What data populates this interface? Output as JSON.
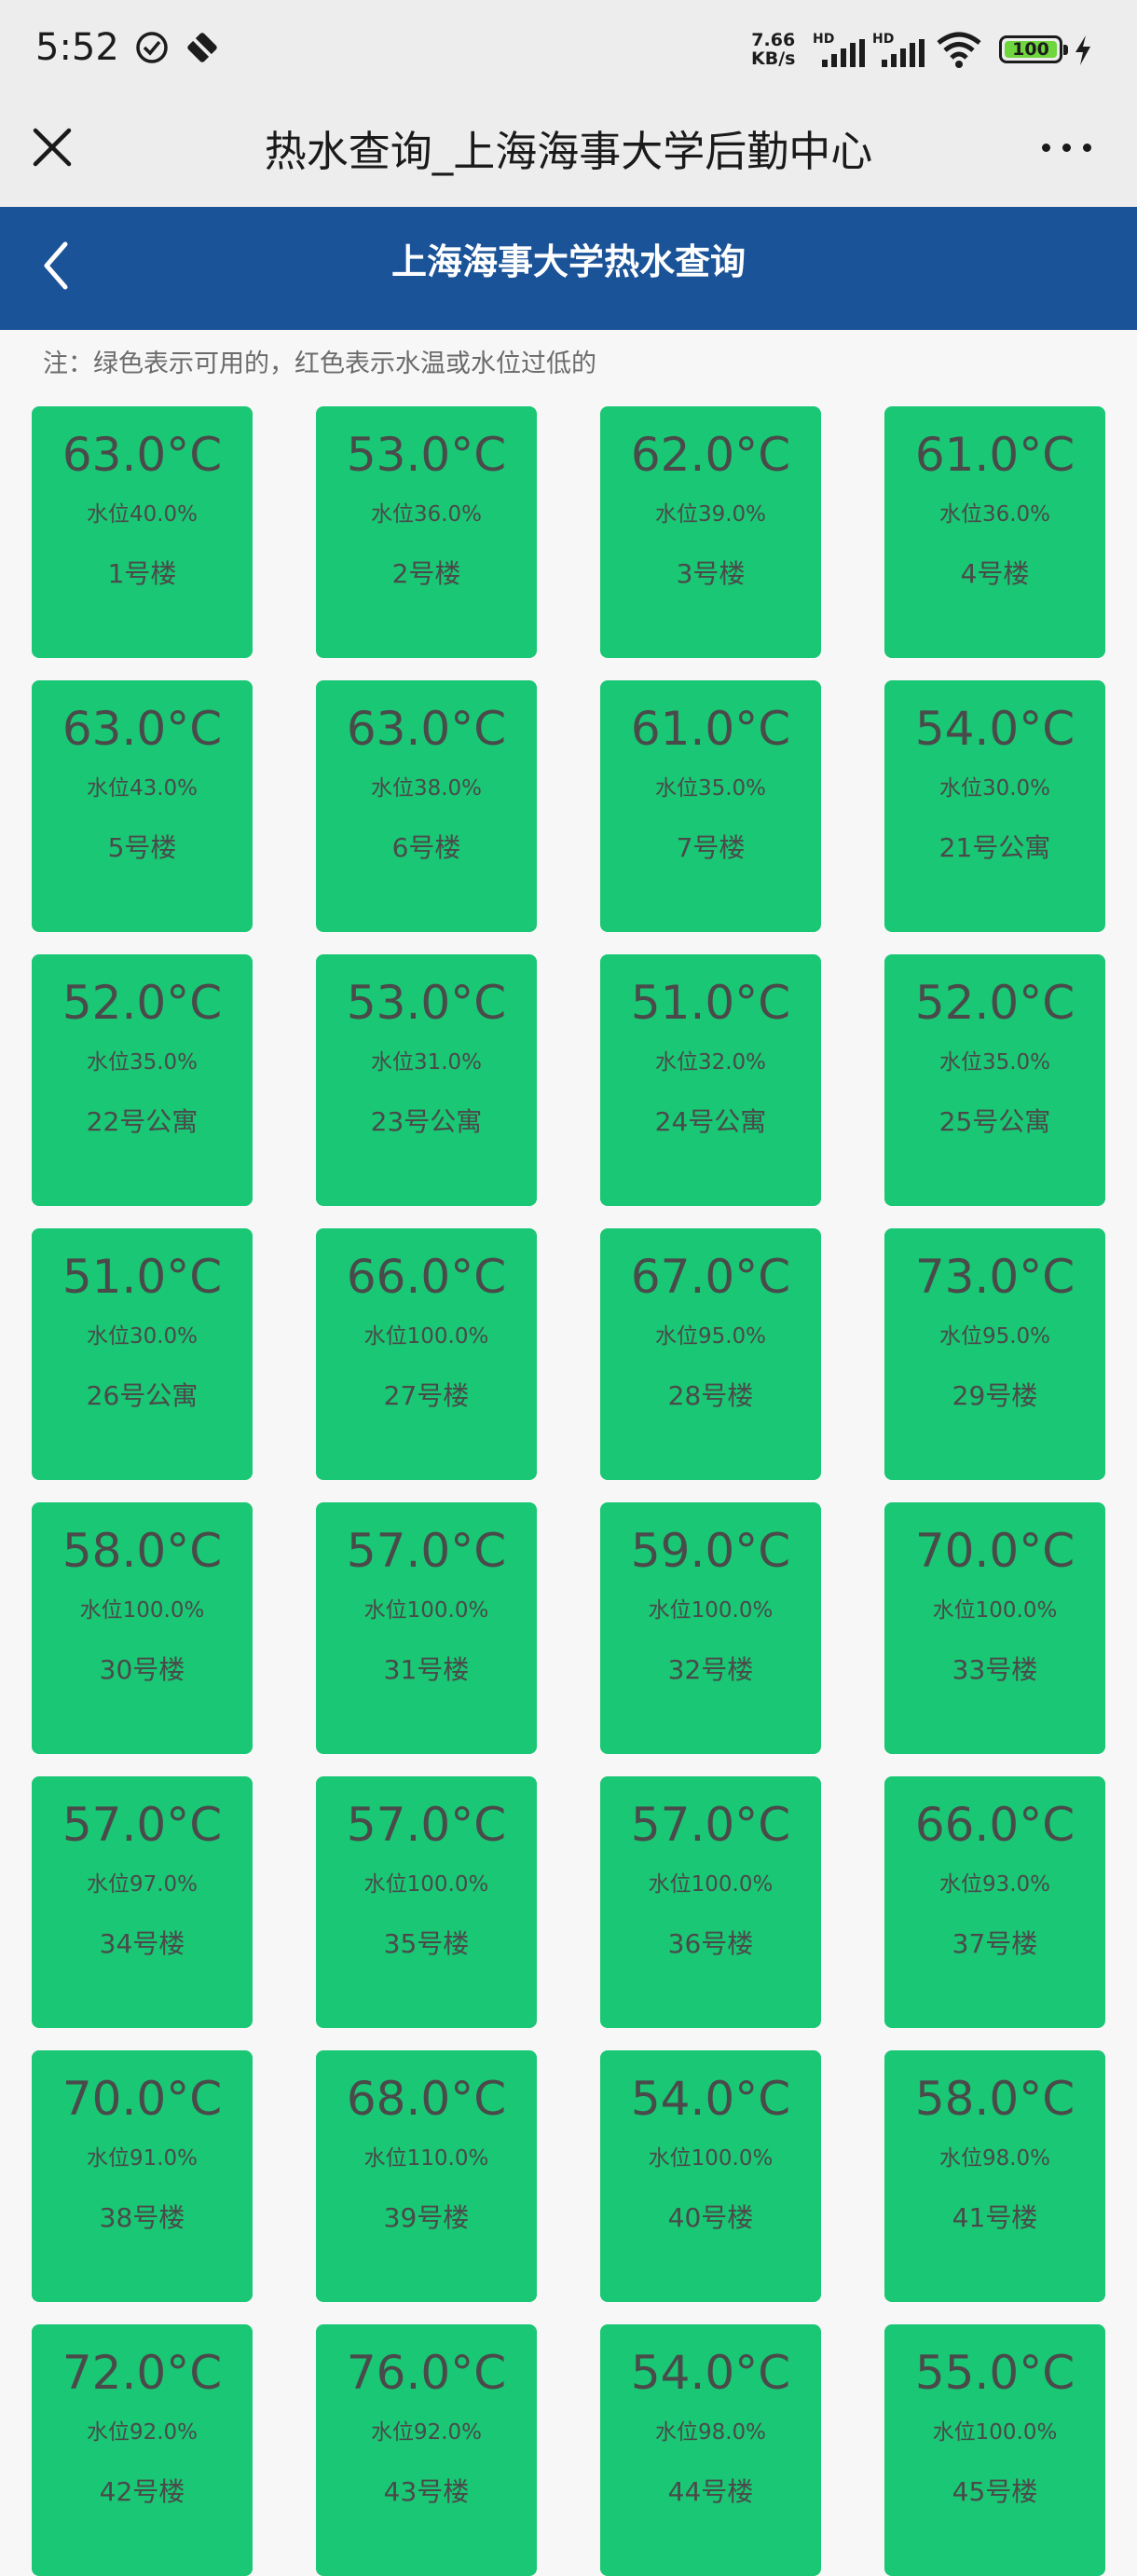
{
  "status_bar": {
    "time": "5:52",
    "speed_value": "7.66",
    "speed_unit": "KB/s",
    "hd1": "HD",
    "hd2": "HD",
    "battery": "100"
  },
  "title_bar": {
    "title": "热水查询_上海海事大学后勤中心"
  },
  "header": {
    "title": "上海海事大学热水查询"
  },
  "note": "注：绿色表示可用的，红色表示水温或水位过低的",
  "colors": {
    "available": "#19c774",
    "header_bg": "#1b5398"
  },
  "cards": [
    {
      "temp": "63.0°C",
      "level": "水位40.0%",
      "name": "1号楼"
    },
    {
      "temp": "53.0°C",
      "level": "水位36.0%",
      "name": "2号楼"
    },
    {
      "temp": "62.0°C",
      "level": "水位39.0%",
      "name": "3号楼"
    },
    {
      "temp": "61.0°C",
      "level": "水位36.0%",
      "name": "4号楼"
    },
    {
      "temp": "63.0°C",
      "level": "水位43.0%",
      "name": "5号楼"
    },
    {
      "temp": "63.0°C",
      "level": "水位38.0%",
      "name": "6号楼"
    },
    {
      "temp": "61.0°C",
      "level": "水位35.0%",
      "name": "7号楼"
    },
    {
      "temp": "54.0°C",
      "level": "水位30.0%",
      "name": "21号公寓"
    },
    {
      "temp": "52.0°C",
      "level": "水位35.0%",
      "name": "22号公寓"
    },
    {
      "temp": "53.0°C",
      "level": "水位31.0%",
      "name": "23号公寓"
    },
    {
      "temp": "51.0°C",
      "level": "水位32.0%",
      "name": "24号公寓"
    },
    {
      "temp": "52.0°C",
      "level": "水位35.0%",
      "name": "25号公寓"
    },
    {
      "temp": "51.0°C",
      "level": "水位30.0%",
      "name": "26号公寓"
    },
    {
      "temp": "66.0°C",
      "level": "水位100.0%",
      "name": "27号楼"
    },
    {
      "temp": "67.0°C",
      "level": "水位95.0%",
      "name": "28号楼"
    },
    {
      "temp": "73.0°C",
      "level": "水位95.0%",
      "name": "29号楼"
    },
    {
      "temp": "58.0°C",
      "level": "水位100.0%",
      "name": "30号楼"
    },
    {
      "temp": "57.0°C",
      "level": "水位100.0%",
      "name": "31号楼"
    },
    {
      "temp": "59.0°C",
      "level": "水位100.0%",
      "name": "32号楼"
    },
    {
      "temp": "70.0°C",
      "level": "水位100.0%",
      "name": "33号楼"
    },
    {
      "temp": "57.0°C",
      "level": "水位97.0%",
      "name": "34号楼"
    },
    {
      "temp": "57.0°C",
      "level": "水位100.0%",
      "name": "35号楼"
    },
    {
      "temp": "57.0°C",
      "level": "水位100.0%",
      "name": "36号楼"
    },
    {
      "temp": "66.0°C",
      "level": "水位93.0%",
      "name": "37号楼"
    },
    {
      "temp": "70.0°C",
      "level": "水位91.0%",
      "name": "38号楼"
    },
    {
      "temp": "68.0°C",
      "level": "水位110.0%",
      "name": "39号楼"
    },
    {
      "temp": "54.0°C",
      "level": "水位100.0%",
      "name": "40号楼"
    },
    {
      "temp": "58.0°C",
      "level": "水位98.0%",
      "name": "41号楼"
    },
    {
      "temp": "72.0°C",
      "level": "水位92.0%",
      "name": "42号楼"
    },
    {
      "temp": "76.0°C",
      "level": "水位92.0%",
      "name": "43号楼"
    },
    {
      "temp": "54.0°C",
      "level": "水位98.0%",
      "name": "44号楼"
    },
    {
      "temp": "55.0°C",
      "level": "水位100.0%",
      "name": "45号楼"
    }
  ]
}
